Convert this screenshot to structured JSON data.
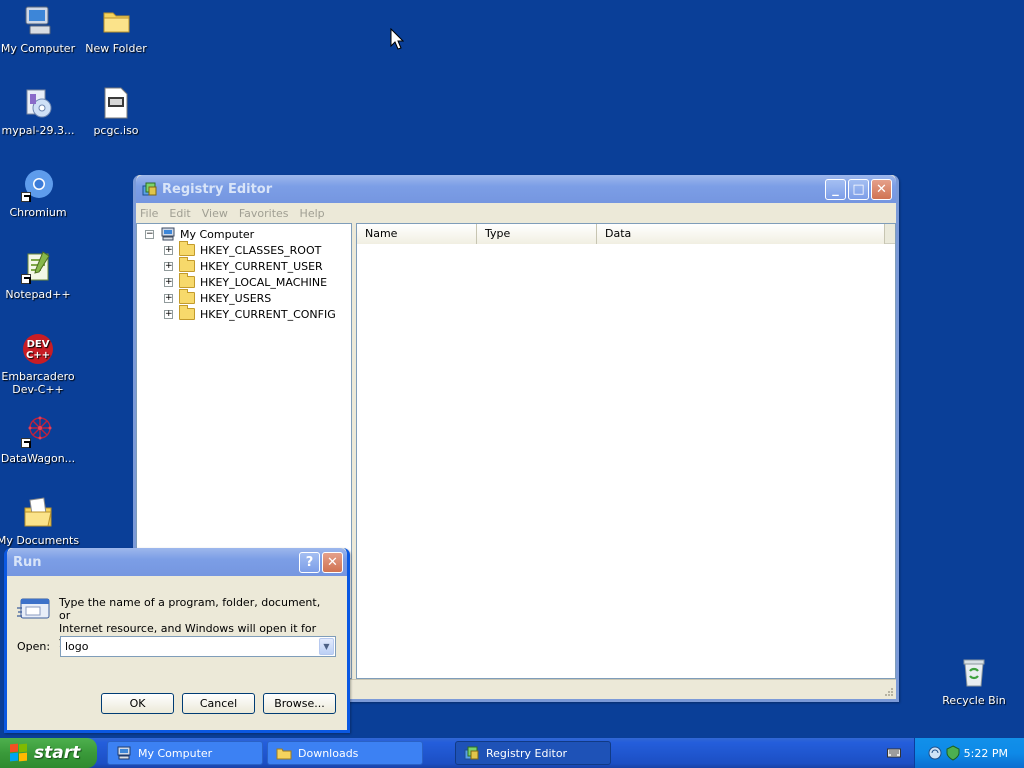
{
  "desktop": {
    "icons": [
      {
        "label": "My Computer"
      },
      {
        "label": "New Folder"
      },
      {
        "label": "mypal-29.3..."
      },
      {
        "label": "pcgc.iso"
      },
      {
        "label": "Chromium"
      },
      {
        "label": "Notepad++"
      },
      {
        "label": "Embarcadero Dev-C++"
      },
      {
        "label": "DataWagon..."
      },
      {
        "label": "My Documents"
      },
      {
        "label": "Recycle Bin"
      }
    ]
  },
  "regedit": {
    "title": "Registry Editor",
    "menu": [
      "File",
      "Edit",
      "View",
      "Favorites",
      "Help"
    ],
    "tree_root": "My Computer",
    "tree_items": [
      "HKEY_CLASSES_ROOT",
      "HKEY_CURRENT_USER",
      "HKEY_LOCAL_MACHINE",
      "HKEY_USERS",
      "HKEY_CURRENT_CONFIG"
    ],
    "columns": [
      "Name",
      "Type",
      "Data"
    ]
  },
  "run": {
    "title": "Run",
    "description_line1": "Type the name of a program, folder, document, or",
    "description_line2": "Internet resource, and Windows will open it for you.",
    "open_label": "Open:",
    "open_value": "logo",
    "ok_label": "OK",
    "cancel_label": "Cancel",
    "browse_label": "Browse..."
  },
  "taskbar": {
    "start_label": "start",
    "tasks": [
      "My Computer",
      "Downloads",
      "Registry Editor"
    ],
    "clock": "5:22 PM"
  },
  "colors": {
    "desktop": "#0a3f98",
    "titlebar_active": "#0a58e2",
    "taskbar": "#245edb",
    "start_green": "#3a9a3a"
  }
}
